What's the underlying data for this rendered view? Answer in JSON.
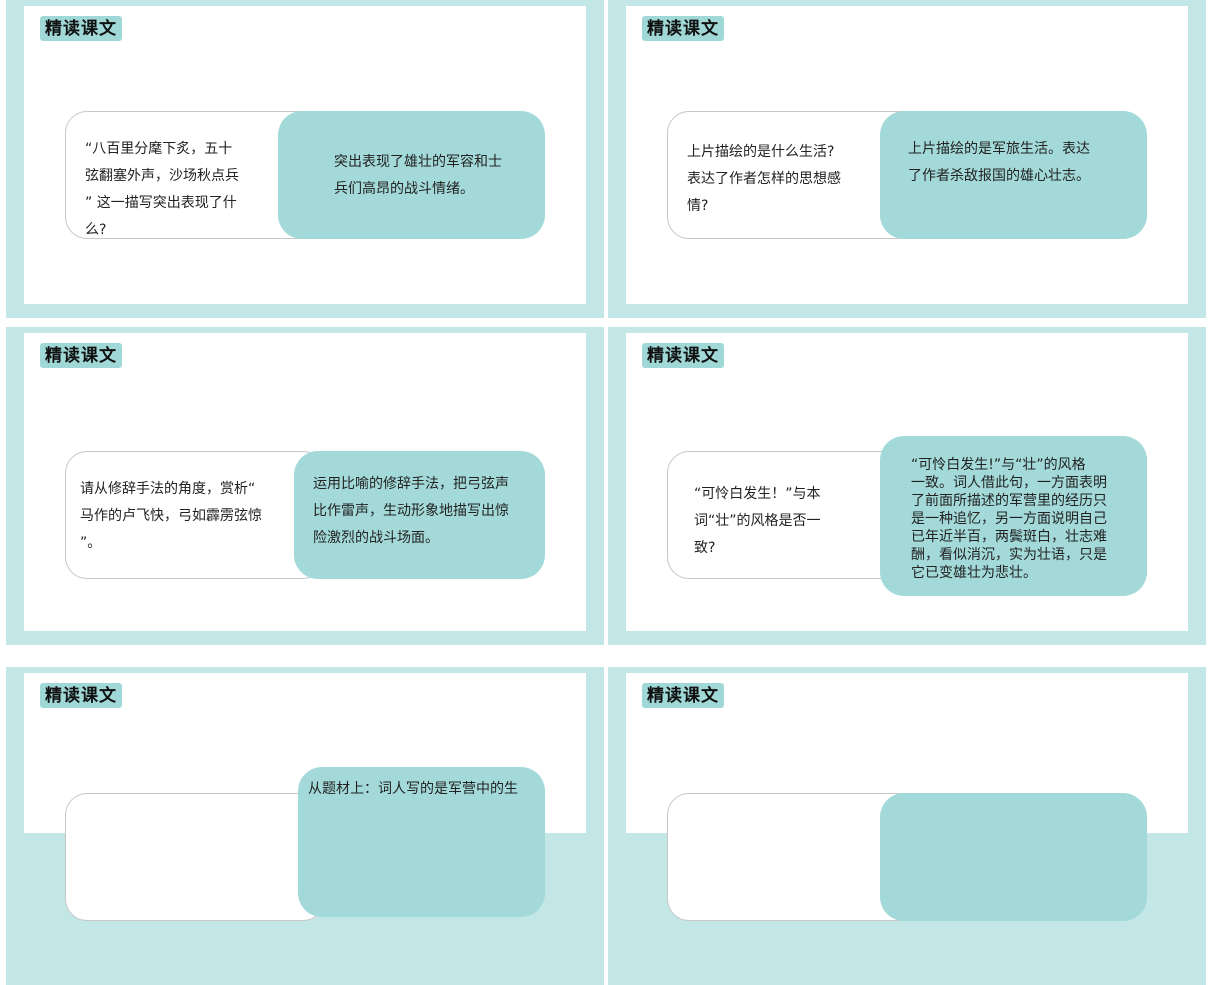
{
  "colors": {
    "frame": "#c3e6e6",
    "tag": "#9fd8d7",
    "answer": "#a3dad9"
  },
  "slides": [
    {
      "title": "精读课文",
      "question": "“八百里分麾下炙，五十\n弦翻塞外声，沙场秋点兵\n” 这一描写突出表现了什\n么?",
      "answer": "突出表现了雄壮的军容和士\n兵们高昂的战斗情绪。"
    },
    {
      "title": "精读课文",
      "question": "上片描绘的是什么生活?\n表达了作者怎样的思想感\n情?",
      "answer": "上片描绘的是军旅生活。表达\n了作者杀敌报国的雄心壮志。"
    },
    {
      "title": "精读课文",
      "question": "请从修辞手法的角度，赏析“\n马作的卢飞快，弓如霹雳弦惊\n”。",
      "answer": "运用比喻的修辞手法，把弓弦声\n比作雷声，生动形象地描写出惊\n险激烈的战斗场面。"
    },
    {
      "title": "精读课文",
      "question": "“可怜白发生！”与本\n词“壮”的风格是否一\n致?",
      "answer": "“可怜白发生!”与“壮”的风格\n一致。词人借此句，一方面表明\n了前面所描述的军营里的经历只\n是一种追忆，另一方面说明自己\n已年近半百，两鬓斑白，壮志难\n酬，看似消沉，实为壮语，只是\n它已变雄壮为悲壮。"
    },
    {
      "title": "精读课文",
      "question": "",
      "answer": "从题材上：词人写的是军营中的生"
    },
    {
      "title": "精读课文",
      "question": "",
      "answer": ""
    }
  ]
}
